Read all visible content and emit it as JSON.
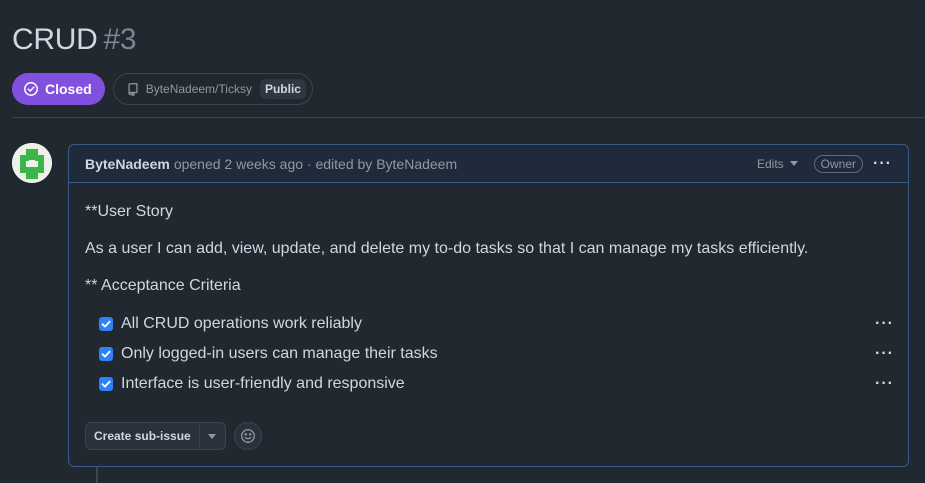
{
  "issue": {
    "title": "CRUD",
    "number": "#3",
    "state": "Closed",
    "state_color": "#8250df",
    "repo": "ByteNadeem/Ticksy",
    "visibility": "Public"
  },
  "comment": {
    "author": "ByteNadeem",
    "meta": "opened 2 weeks ago · edited by ByteNadeem",
    "edits_label": "Edits",
    "role_badge": "Owner",
    "paragraphs": [
      "**User Story",
      "As a user I can add, view, update, and delete my to-do tasks so that I can manage my tasks efficiently.",
      "** Acceptance Criteria"
    ],
    "tasks": [
      {
        "label": "All CRUD operations work reliably",
        "checked": true
      },
      {
        "label": "Only logged-in users can manage their tasks",
        "checked": true
      },
      {
        "label": "Interface is user-friendly and responsive",
        "checked": true
      }
    ],
    "create_sub_issue_label": "Create sub-issue"
  },
  "icons": {
    "state": "issue-closed-icon",
    "repo": "repo-icon",
    "more": "kebab-horizontal-icon",
    "reaction": "smiley-icon"
  },
  "colors": {
    "background": "#212830",
    "checkbox": "#2f81f7",
    "comment_border": "#3a5a8a"
  }
}
